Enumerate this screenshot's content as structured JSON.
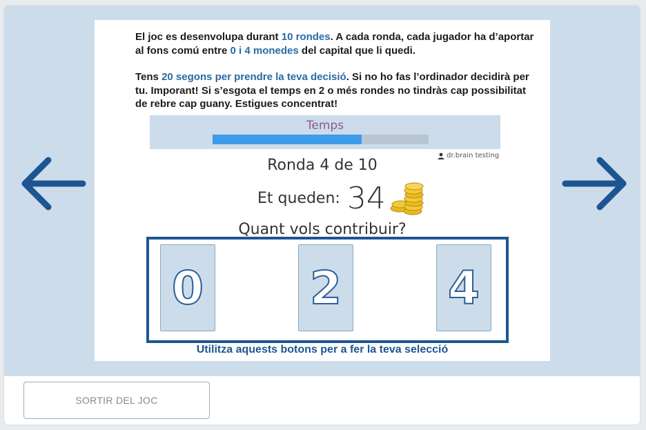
{
  "intro": {
    "p1_a": "El joc es desenvolupa durant ",
    "p1_hl1": "10 rondes",
    "p1_b": ". A cada ronda, cada jugador ha d’aportar al fons comú entre ",
    "p1_hl2": "0 i 4 monedes",
    "p1_c": " del capital que li quedi.",
    "p2_a": "Tens ",
    "p2_hl": "20 segons per prendre la teva decisió",
    "p2_b": ". Si no ho fas l’ordinador decidirà per tu. Imporant! Si s’esgota el temps en 2 o més rondes no tindràs cap possibilitat de rebre cap guany. Estigues concentrat!"
  },
  "timer": {
    "label": "Temps",
    "progress": 0.69
  },
  "user": {
    "name": "dr.brain testing",
    "icon": "user-icon"
  },
  "round": "Ronda 4 de 10",
  "remaining": {
    "label": "Et queden:",
    "value": "34",
    "icon": "coins-icon"
  },
  "question": "Quant vols contribuir?",
  "choices": [
    "0",
    "2",
    "4"
  ],
  "hint": "Utilitza aquests botons per a fer la teva selecció",
  "nav": {
    "prev_icon": "arrow-left-icon",
    "next_icon": "arrow-right-icon"
  },
  "footer": {
    "exit_label": "SORTIR DEL JOC"
  },
  "colors": {
    "stage_bg": "#cddcea",
    "accent": "#1d5592",
    "highlight": "#2a6aa3",
    "timer_fill": "#3d9be9",
    "timer_label": "#8e5a86"
  }
}
